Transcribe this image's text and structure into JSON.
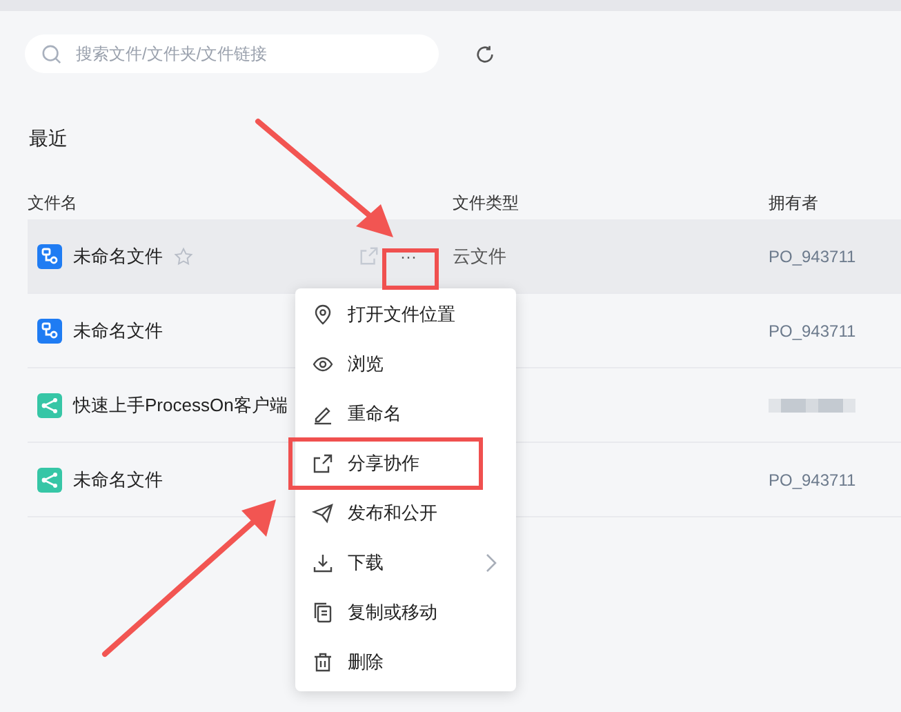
{
  "search": {
    "placeholder": "搜索文件/文件夹/文件链接"
  },
  "section_title": "最近",
  "table": {
    "columns": [
      "文件名",
      "文件类型",
      "拥有者"
    ],
    "rows": [
      {
        "kind": "flowchart",
        "name": "未命名文件",
        "file_type": "云文件",
        "owner": "PO_943711",
        "hovered": true,
        "starred": false
      },
      {
        "kind": "flowchart",
        "name": "未命名文件",
        "owner": "PO_943711"
      },
      {
        "kind": "mindmap",
        "name": "快速上手ProcessOn客户端",
        "owner_redacted": true
      },
      {
        "kind": "mindmap",
        "name": "未命名文件",
        "owner": "PO_943711"
      }
    ]
  },
  "more_button": {
    "label": "···"
  },
  "context_menu": [
    {
      "kind": "location",
      "label": "打开文件位置"
    },
    {
      "kind": "view",
      "label": "浏览"
    },
    {
      "kind": "rename",
      "label": "重命名"
    },
    {
      "kind": "share",
      "label": "分享协作"
    },
    {
      "kind": "publish",
      "label": "发布和公开"
    },
    {
      "kind": "download",
      "label": "下载",
      "submenu": true
    },
    {
      "kind": "copy",
      "label": "复制或移动"
    },
    {
      "kind": "delete",
      "label": "删除"
    }
  ]
}
